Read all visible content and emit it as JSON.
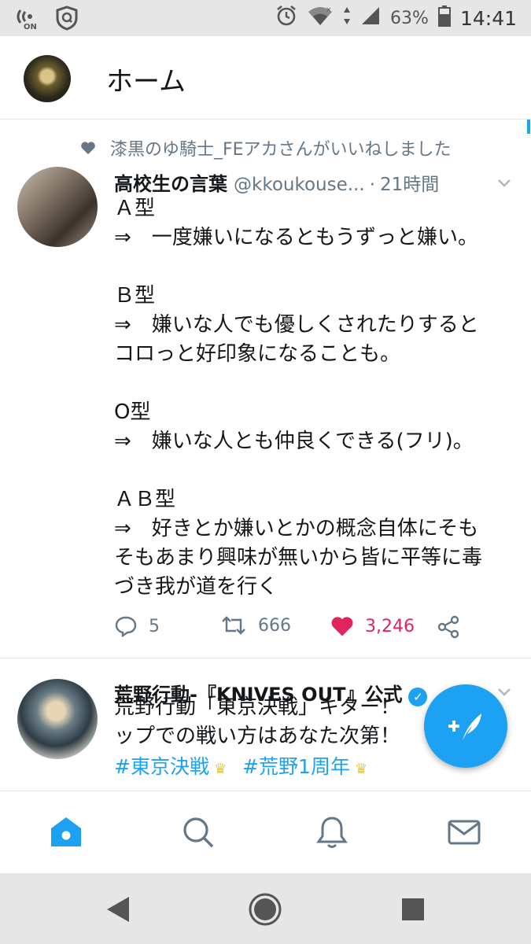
{
  "status_bar": {
    "battery_percent": "63%",
    "time": "14:41",
    "nfc_label": "ON"
  },
  "header": {
    "title": "ホーム"
  },
  "tweets": [
    {
      "social_context": "漆黒のゆ騎士_FEアカさんがいいねしました",
      "name": "高校生の言葉",
      "handle": "@kkoukouse...",
      "separator": "·",
      "time": "21時間",
      "text": "Ａ型\n⇒　一度嫌いになるともうずっと嫌い。\n\nＢ型\n⇒　嫌いな人でも優しくされたりすると\nコロっと好印象になることも。\n\nO型\n⇒　嫌いな人とも仲良くできる(フリ)。\n\nＡＢ型\n⇒　好きとか嫌いとかの概念自体にそも\nそもあまり興味が無いから皆に平等に毒\nづき我が道を行く",
      "replies": "5",
      "retweets": "666",
      "likes": "3,246",
      "liked": true
    },
    {
      "name": "荒野行動-『KNIVES OUT』公式",
      "text": "荒野行動「東京決戦」キター！　　マ\nップでの戦い方はあなた次第！",
      "hashtags": [
        "#東京決戦",
        "#荒野1周年"
      ]
    }
  ],
  "colors": {
    "accent": "#1da1f2",
    "like": "#e0245e",
    "secondary_text": "#657786"
  },
  "icons": {
    "tab_bar": [
      "home-icon",
      "search-icon",
      "notifications-icon",
      "messages-icon"
    ],
    "fab": "compose-tweet-icon"
  }
}
